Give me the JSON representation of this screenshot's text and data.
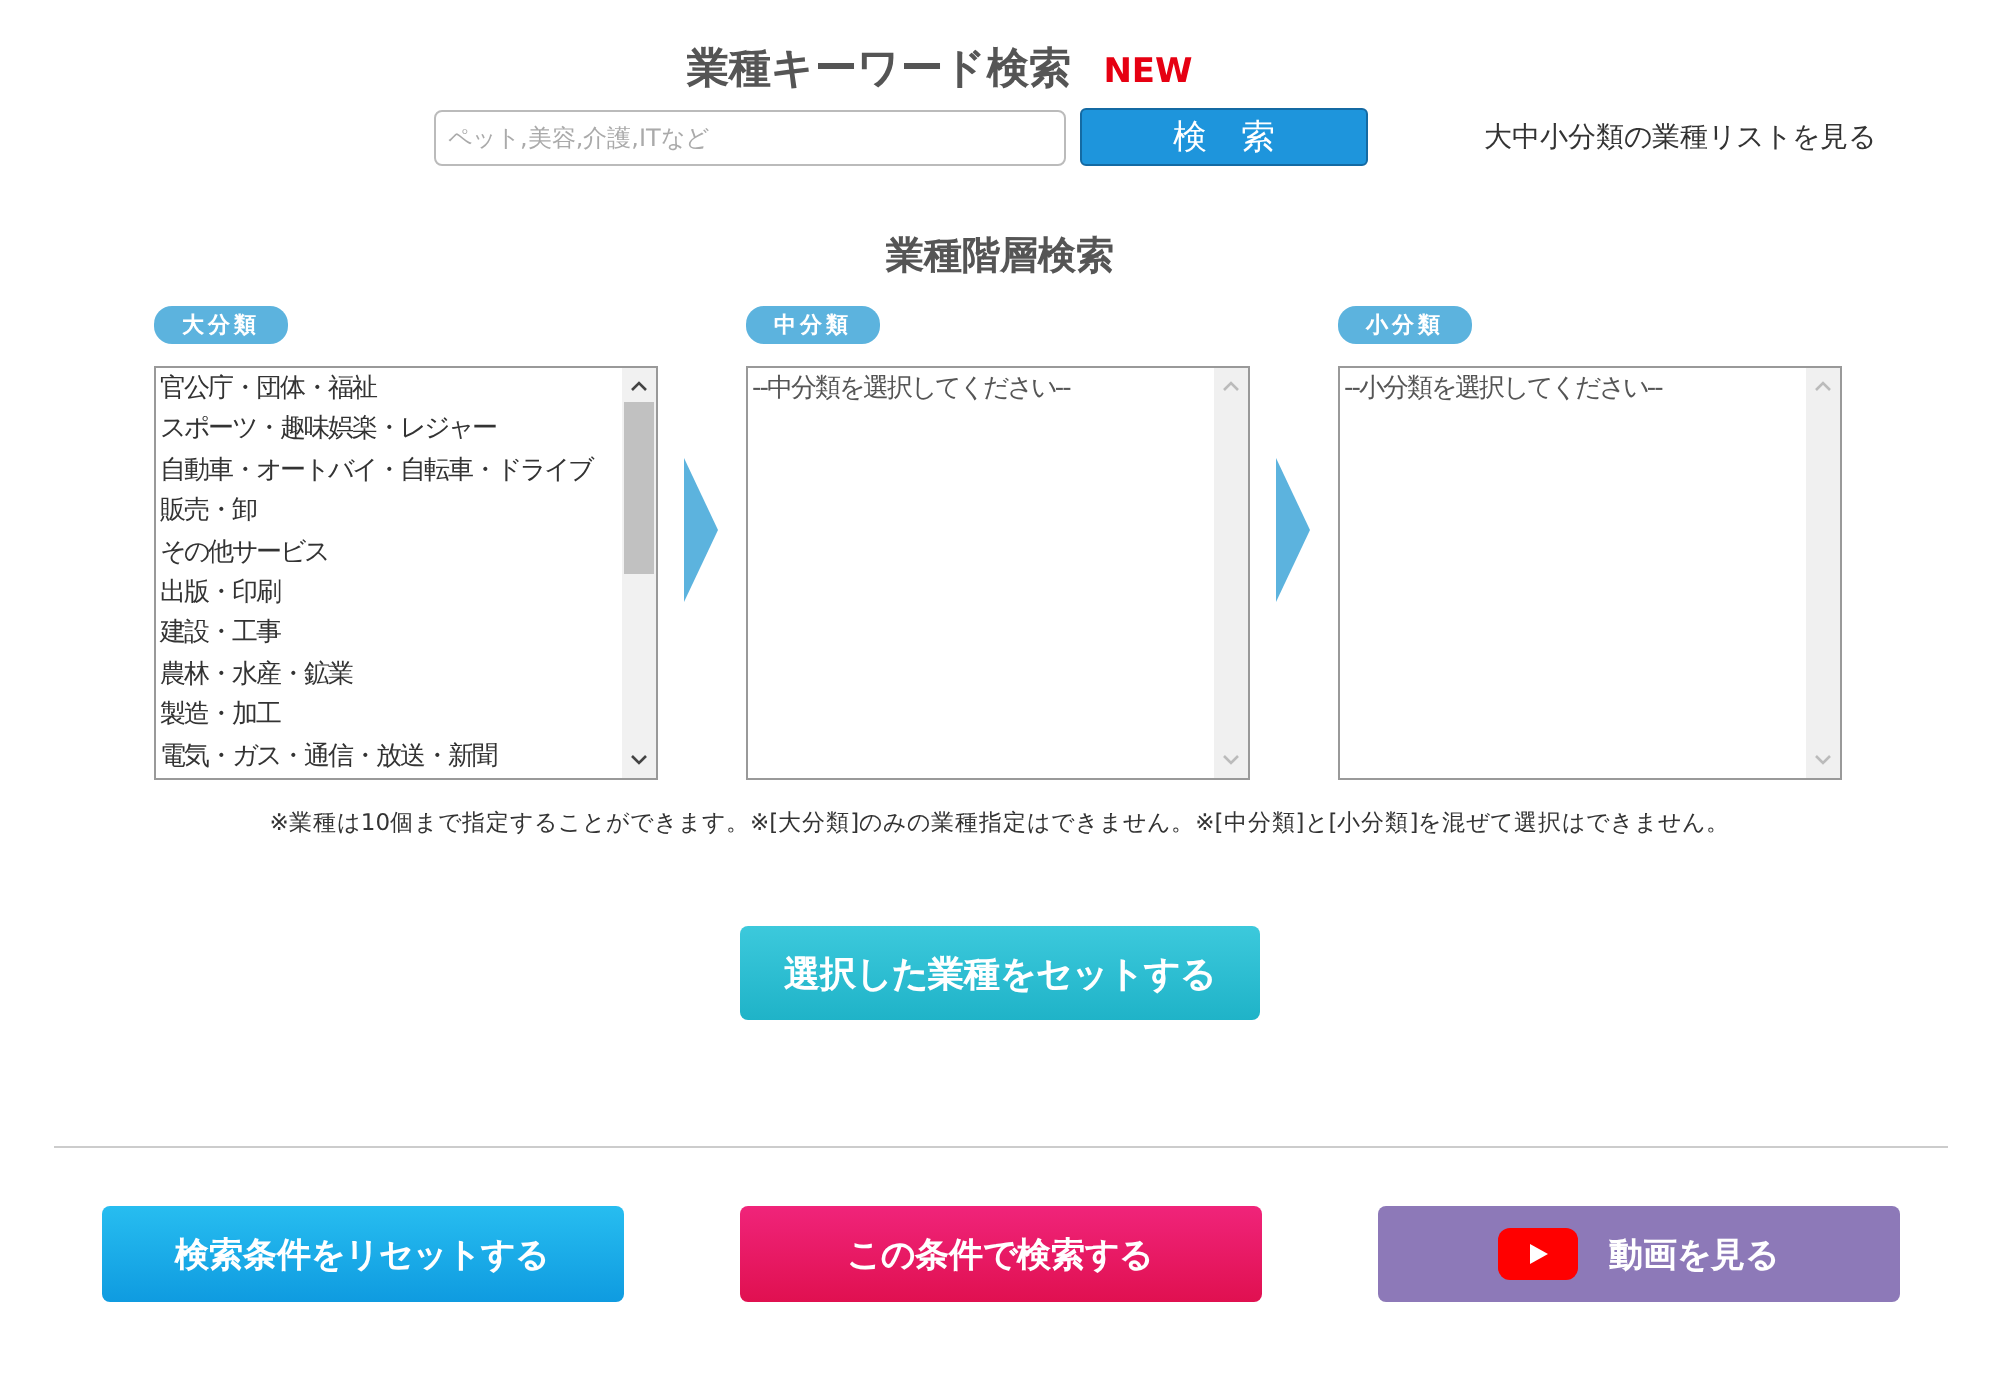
{
  "keyword_search": {
    "title": "業種キーワード検索",
    "badge": "NEW",
    "placeholder": "ペット,美容,介護,ITなど",
    "button": "検　索",
    "list_link": "大中小分類の業種リストを見る"
  },
  "hierarchy": {
    "title": "業種階層検索",
    "columns": [
      {
        "label": "大分類",
        "scroll_thumb": true,
        "items": [
          "官公庁・団体・福祉",
          "スポーツ・趣味娯楽・レジャー",
          "自動車・オートバイ・自転車・ドライブ",
          "販売・卸",
          "その他サービス",
          "出版・印刷",
          "建設・工事",
          "農林・水産・鉱業",
          "製造・加工",
          "電気・ガス・通信・放送・新聞"
        ]
      },
      {
        "label": "中分類",
        "scroll_thumb": false,
        "items": [
          "--中分類を選択してください--"
        ]
      },
      {
        "label": "小分類",
        "scroll_thumb": false,
        "items": [
          "--小分類を選択してください--"
        ]
      }
    ],
    "note": "※業種は10個まで指定することができます。※[大分類]のみの業種指定はできません。※[中分類]と[小分類]を混ぜて選択はできません。",
    "set_button": "選択した業種をセットする"
  },
  "footer_buttons": [
    {
      "kind": "reset",
      "label": "検索条件をリセットする"
    },
    {
      "kind": "search",
      "label": "この条件で検索する"
    },
    {
      "kind": "video",
      "label": "動画を見る"
    }
  ]
}
